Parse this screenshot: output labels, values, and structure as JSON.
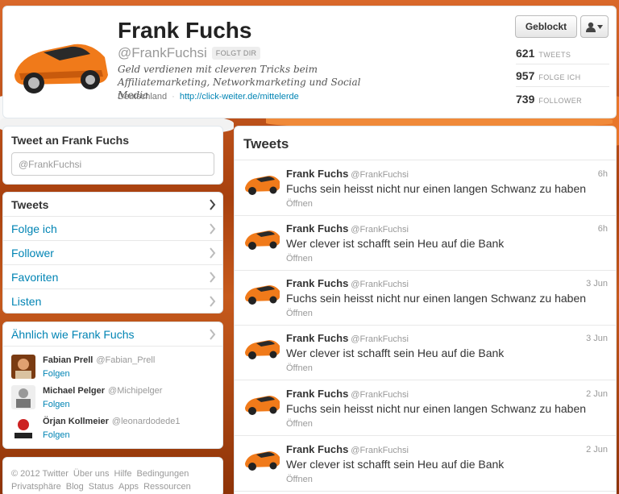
{
  "profile": {
    "name": "Frank Fuchs",
    "handle": "@FrankFuchsi",
    "follows_you_badge": "FOLGT DIR",
    "bio": "Geld verdienen mit cleveren Tricks beim Affiliatemarketing, Networkmarketing und Social Media",
    "location": "Deutschland",
    "url": "http://click-weiter.de/mittelerde",
    "blocked_label": "Geblockt",
    "user_menu_icon": "person-dropdown-icon",
    "stats": [
      {
        "value": "621",
        "label": "TWEETS"
      },
      {
        "value": "957",
        "label": "FOLGE ICH"
      },
      {
        "value": "739",
        "label": "FOLLOWER"
      }
    ]
  },
  "tweet_to": {
    "title": "Tweet an Frank Fuchs",
    "input_value": "@FrankFuchsi"
  },
  "nav": {
    "items": [
      {
        "label": "Tweets",
        "active": true
      },
      {
        "label": "Folge ich"
      },
      {
        "label": "Follower"
      },
      {
        "label": "Favoriten"
      },
      {
        "label": "Listen"
      }
    ]
  },
  "similar": {
    "title": "Ähnlich wie Frank Fuchs",
    "users": [
      {
        "name": "Fabian Prell",
        "handle": "@Fabian_Prell",
        "follow": "Folgen"
      },
      {
        "name": "Michael Pelger",
        "handle": "@Michipelger",
        "follow": "Folgen"
      },
      {
        "name": "Örjan Kollmeier",
        "handle": "@leonardodede1",
        "follow": "Folgen"
      }
    ]
  },
  "footer": {
    "line1": [
      "© 2012 Twitter",
      "Über uns",
      "Hilfe",
      "Bedingungen"
    ],
    "line2": [
      "Privatsphäre",
      "Blog",
      "Status",
      "Apps",
      "Ressourcen"
    ]
  },
  "tweets": {
    "title": "Tweets",
    "items": [
      {
        "name": "Frank Fuchs",
        "handle": "@FrankFuchsi",
        "time": "6h",
        "text": "Fuchs sein heisst nicht nur einen langen Schwanz zu haben",
        "open": "Öffnen"
      },
      {
        "name": "Frank Fuchs",
        "handle": "@FrankFuchsi",
        "time": "6h",
        "text": "Wer clever ist schafft sein Heu auf die Bank",
        "open": "Öffnen"
      },
      {
        "name": "Frank Fuchs",
        "handle": "@FrankFuchsi",
        "time": "3 Jun",
        "text": "Fuchs sein heisst nicht nur einen langen Schwanz zu haben",
        "open": "Öffnen"
      },
      {
        "name": "Frank Fuchs",
        "handle": "@FrankFuchsi",
        "time": "3 Jun",
        "text": "Wer clever ist schafft sein Heu auf die Bank",
        "open": "Öffnen"
      },
      {
        "name": "Frank Fuchs",
        "handle": "@FrankFuchsi",
        "time": "2 Jun",
        "text": "Fuchs sein heisst nicht nur einen langen Schwanz zu haben",
        "open": "Öffnen"
      },
      {
        "name": "Frank Fuchs",
        "handle": "@FrankFuchsi",
        "time": "2 Jun",
        "text": "Wer clever ist schafft sein Heu auf die Bank",
        "open": "Öffnen"
      }
    ]
  },
  "colors": {
    "link": "#0084b4",
    "muted": "#999999",
    "accent_car": "#f07a1a"
  }
}
